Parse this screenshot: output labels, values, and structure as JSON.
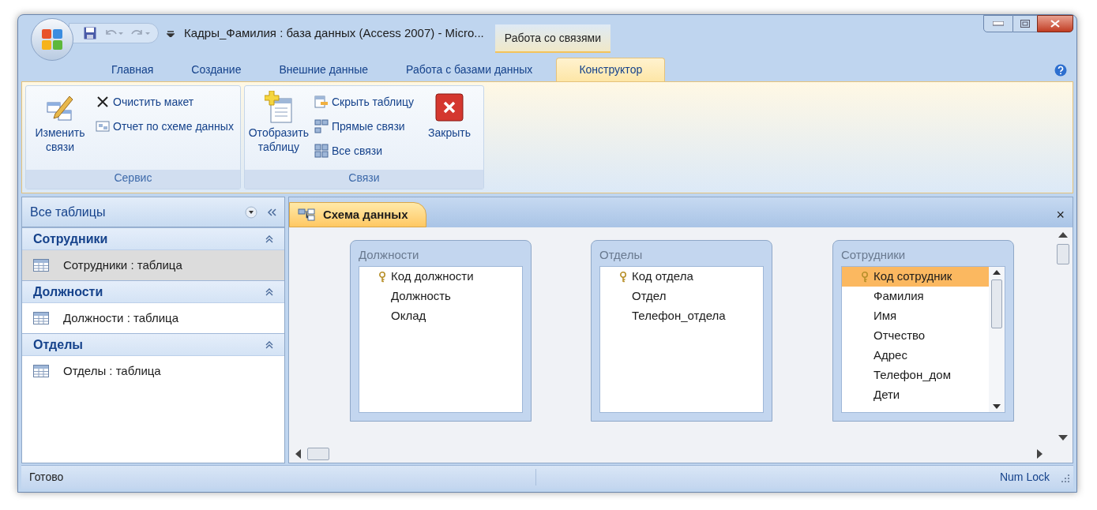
{
  "window": {
    "title": "Кадры_Фамилия : база данных (Access 2007) - Micro...",
    "context_tab": "Работа со связями"
  },
  "ribbon_tabs": [
    {
      "label": "Главная",
      "selected": false
    },
    {
      "label": "Создание",
      "selected": false
    },
    {
      "label": "Внешние данные",
      "selected": false
    },
    {
      "label": "Работа с базами данных",
      "selected": false
    },
    {
      "label": "Конструктор",
      "selected": true
    }
  ],
  "ribbon_groups": [
    {
      "label": "Сервис",
      "items": [
        {
          "kind": "large",
          "label": "Изменить связи"
        },
        {
          "kind": "stack",
          "entries": [
            {
              "label": "Очистить макет"
            },
            {
              "label": "Отчет по схеме данных"
            }
          ]
        }
      ]
    },
    {
      "label": "Связи",
      "items": [
        {
          "kind": "large",
          "label": "Отобразить таблицу"
        },
        {
          "kind": "stack",
          "entries": [
            {
              "label": "Скрыть таблицу"
            },
            {
              "label": "Прямые связи"
            },
            {
              "label": "Все связи"
            }
          ]
        },
        {
          "kind": "large",
          "label": "Закрыть"
        }
      ]
    }
  ],
  "nav_pane": {
    "title": "Все таблицы",
    "groups": [
      {
        "label": "Сотрудники",
        "items": [
          {
            "label": "Сотрудники : таблица",
            "selected": true
          }
        ]
      },
      {
        "label": "Должности",
        "items": [
          {
            "label": "Должности : таблица",
            "selected": false
          }
        ]
      },
      {
        "label": "Отделы",
        "items": [
          {
            "label": "Отделы : таблица",
            "selected": false
          }
        ]
      }
    ]
  },
  "document_tab": {
    "label": "Схема данных",
    "close": "×"
  },
  "tables": [
    {
      "title": "Должности",
      "scrollbar": false,
      "fields": [
        {
          "name": "Код должности",
          "key": true,
          "selected": false
        },
        {
          "name": "Должность",
          "key": false,
          "selected": false
        },
        {
          "name": "Оклад",
          "key": false,
          "selected": false
        }
      ]
    },
    {
      "title": "Отделы",
      "scrollbar": false,
      "fields": [
        {
          "name": "Код отдела",
          "key": true,
          "selected": false
        },
        {
          "name": "Отдел",
          "key": false,
          "selected": false
        },
        {
          "name": "Телефон_отдела",
          "key": false,
          "selected": false
        }
      ]
    },
    {
      "title": "Сотрудники",
      "scrollbar": true,
      "fields": [
        {
          "name": "Код сотрудник",
          "key": true,
          "selected": true
        },
        {
          "name": "Фамилия",
          "key": false,
          "selected": false
        },
        {
          "name": "Имя",
          "key": false,
          "selected": false
        },
        {
          "name": "Отчество",
          "key": false,
          "selected": false
        },
        {
          "name": "Адрес",
          "key": false,
          "selected": false
        },
        {
          "name": "Телефон_дом",
          "key": false,
          "selected": false
        },
        {
          "name": "Дети",
          "key": false,
          "selected": false
        }
      ]
    }
  ],
  "status_bar": {
    "left": "Готово",
    "right": "Num Lock"
  }
}
